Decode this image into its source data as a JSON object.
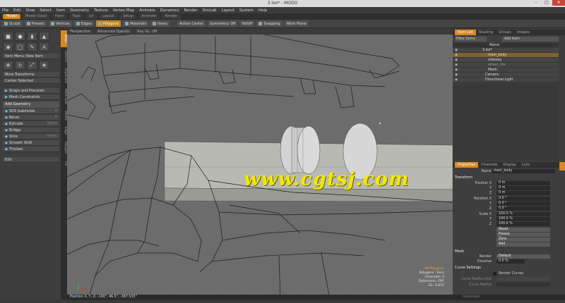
{
  "window": {
    "title": "3.lxo* - MODO"
  },
  "menu": [
    "File",
    "Edit",
    "View",
    "Select",
    "Item",
    "Geometry",
    "Texture",
    "Vertex Map",
    "Animate",
    "Dynamics",
    "Render",
    "SimLab",
    "Layout",
    "System",
    "Help"
  ],
  "layout_tabs": [
    "Model",
    "Model Quad",
    "Paint",
    "Topo",
    "UV",
    "Layout",
    "Setup",
    "Animate",
    "Render"
  ],
  "toolbar": [
    "Sculpt",
    "Presets",
    "Vertices",
    "Edges",
    "Polygons",
    "Materials",
    "Items",
    "Action Center",
    "Symmetry: Off",
    "Falloff",
    "Snapping",
    "Work Plane"
  ],
  "toolbar_active": "Polygons",
  "left_vertical_tabs": [
    "Basic",
    "Deform",
    "Duplicate",
    "Mesh Edit",
    "Vertex",
    "Edge",
    "Polygon",
    "UV"
  ],
  "left_dropdowns": {
    "item_menu": "Item Menu: New Item",
    "more_transforms": "More Transforms",
    "center_selected": "Center Selected",
    "edit": "Edit"
  },
  "left_tools": [
    {
      "label": "Snaps and Precision",
      "hotkey": ""
    },
    {
      "label": "Mesh Constraints",
      "hotkey": ""
    },
    {
      "label": "Add Geometry",
      "hotkey": ""
    },
    {
      "label": "SDS Subdivide",
      "hotkey": "D"
    },
    {
      "label": "Bevel",
      "hotkey": "B"
    },
    {
      "label": "Extrude",
      "hotkey": "Shift-X"
    },
    {
      "label": "Bridge",
      "hotkey": ""
    },
    {
      "label": "Slice",
      "hotkey": "Shift-C"
    },
    {
      "label": "Smooth Shift",
      "hotkey": ""
    },
    {
      "label": "Thicken",
      "hotkey": ""
    }
  ],
  "viewport": {
    "header": [
      "Perspective",
      "Advanced OpenGL",
      "Ray GL: Off"
    ],
    "watermark": "www.cgtsj.com",
    "hud": {
      "selection": "All Polygons",
      "polygons": "Polygons : Face",
      "channels": "Channels: 0",
      "deformers": "Deformers: OFF",
      "gl": "GL: 5,972"
    },
    "status": "Position X, Y, Z:  -100\", 46.5\", -387.535\""
  },
  "right_top_tabs": [
    "Item List",
    "Shading",
    "Groups",
    "Images"
  ],
  "item_list": {
    "filter_label": "Filter Items",
    "add_item": "Add Item",
    "name_header": "Name",
    "items": [
      {
        "name": "3.lxo*",
        "indent": 0,
        "selected": false
      },
      {
        "name": "main_body",
        "indent": 1,
        "selected": true
      },
      {
        "name": "sideway",
        "indent": 1,
        "selected": false
      },
      {
        "name": "wheel_tire",
        "indent": 1,
        "selected": false
      },
      {
        "name": "Mesh",
        "indent": 1,
        "selected": false
      },
      {
        "name": "Camera",
        "indent": 1,
        "selected": false
      },
      {
        "name": "Directional Light",
        "indent": 1,
        "selected": false
      }
    ]
  },
  "right_bottom_tabs": [
    "Properties",
    "Channels",
    "Display",
    "Lists"
  ],
  "properties": {
    "name_label": "Name",
    "name_value": "main_body",
    "transform_header": "Transform",
    "position_label": "Position X",
    "position": [
      "0 m",
      "0 m",
      "0 m"
    ],
    "rotation_label": "Rotation X",
    "rotation": [
      "0.0 °",
      "0.0 °",
      "0.0 °"
    ],
    "scale_label": "Scale X",
    "scale": [
      "100.0 %",
      "100.0 %",
      "100.0 %"
    ],
    "axis": [
      "Y",
      "Z"
    ],
    "buttons": [
      "Reset",
      "Freeze",
      "Zero",
      "Add"
    ],
    "mesh_header": "Mesh",
    "render_label": "Render",
    "render_value": "Default",
    "dissolve_label": "Dissolve",
    "dissolve_value": "0.0 %",
    "curve_header": "Curve Settings",
    "render_curves": "Render Curves",
    "curve_radius_unit": "Curve Radius Unit",
    "curve_radius": "Curve Radius"
  },
  "command_placeholder": "Command"
}
